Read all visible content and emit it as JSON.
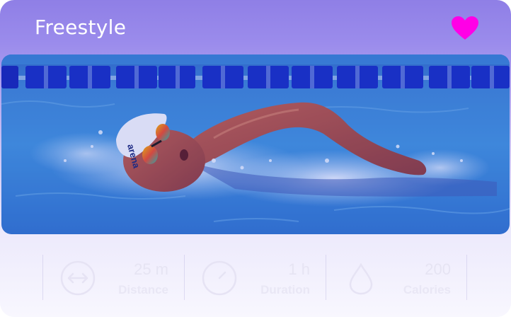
{
  "card": {
    "title": "Freestyle",
    "favorite": true,
    "accent_color": "#ff00e6",
    "header_color": "#8f7fe6",
    "image_alt": "Swimmer doing freestyle in a pool lane, wearing an arena swim cap and mirrored goggles",
    "cap_text": "arena"
  },
  "stats": [
    {
      "icon": "distance-arrows-icon",
      "value": "25 m",
      "label": "Distance"
    },
    {
      "icon": "clock-icon",
      "value": "1 h",
      "label": "Duration"
    },
    {
      "icon": "water-drop-icon",
      "value": "200",
      "label": "Calories"
    }
  ]
}
